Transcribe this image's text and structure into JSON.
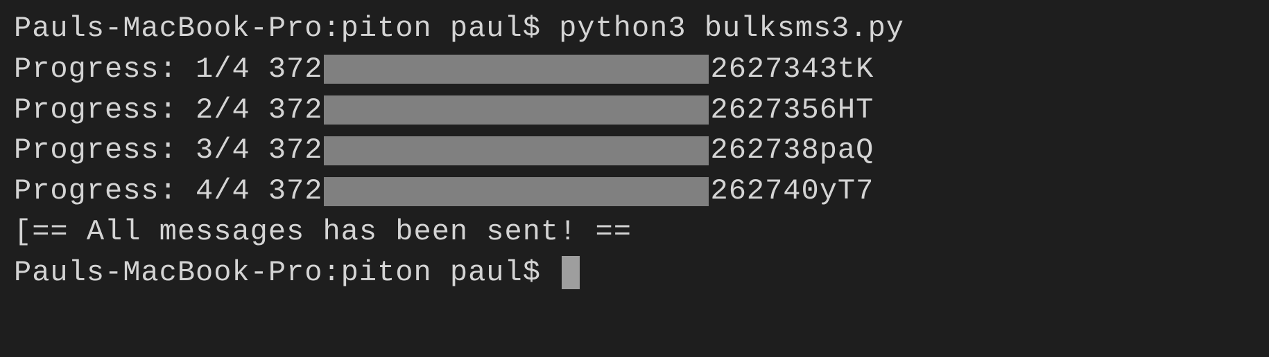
{
  "terminal": {
    "prompt": "Pauls-MacBook-Pro:piton paul$ ",
    "command": "python3 bulksms3.py",
    "progress_lines": [
      {
        "label": "Progress: 1/4 372",
        "suffix": "2627343tK"
      },
      {
        "label": "Progress: 2/4 372",
        "suffix": "2627356HT"
      },
      {
        "label": "Progress: 3/4 372",
        "suffix": "262738paQ"
      },
      {
        "label": "Progress: 4/4 372",
        "suffix": "262740yT7"
      }
    ],
    "status_message": "[== All messages has been sent! ==",
    "final_prompt": "Pauls-MacBook-Pro:piton paul$ "
  }
}
